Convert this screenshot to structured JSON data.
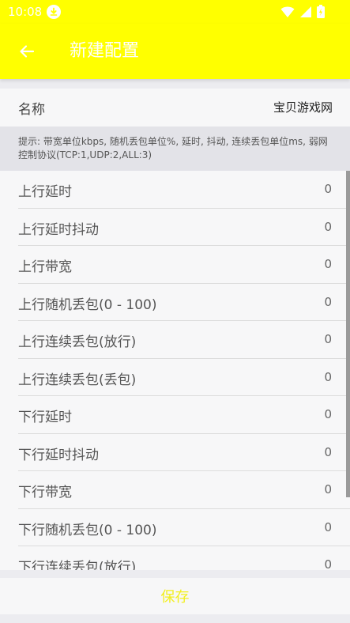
{
  "status_bar": {
    "time": "10:08",
    "download_icon": "download-icon",
    "wifi_icon": "wifi-icon",
    "signal_icon": "signal-icon",
    "battery_icon": "battery-icon"
  },
  "app_bar": {
    "back_icon": "arrow-left-icon",
    "title": "新建配置",
    "background": "#ffff00"
  },
  "name_field": {
    "label": "名称",
    "value": "宝贝游戏网"
  },
  "hint": "提示: 带宽单位kbps, 随机丢包单位%, 延时, 抖动, 连续丢包单位ms, 弱网控制协议(TCP:1,UDP:2,ALL:3)",
  "settings": [
    {
      "label": "上行延时",
      "value": "0"
    },
    {
      "label": "上行延时抖动",
      "value": "0"
    },
    {
      "label": "上行带宽",
      "value": "0"
    },
    {
      "label": "上行随机丢包(0 - 100)",
      "value": "0"
    },
    {
      "label": "上行连续丢包(放行)",
      "value": "0"
    },
    {
      "label": "上行连续丢包(丢包)",
      "value": "0"
    },
    {
      "label": "下行延时",
      "value": "0"
    },
    {
      "label": "下行延时抖动",
      "value": "0"
    },
    {
      "label": "下行带宽",
      "value": "0"
    },
    {
      "label": "下行随机丢包(0 - 100)",
      "value": "0"
    },
    {
      "label": "下行连续丢包(放行)",
      "value": "0"
    }
  ],
  "save_button": {
    "label": "保存",
    "color": "#f2ef1e"
  }
}
